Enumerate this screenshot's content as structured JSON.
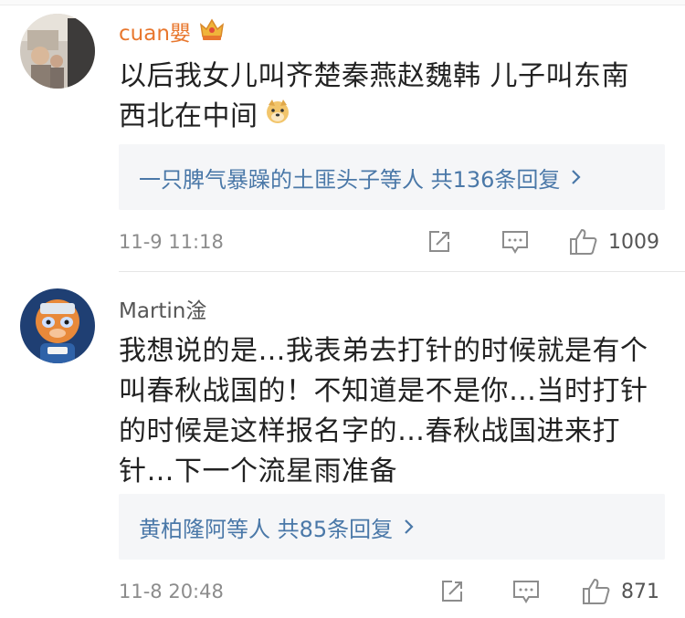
{
  "comments": [
    {
      "user": "cuan嬰",
      "text_lines": [
        "以后我女儿叫齐楚秦燕赵魏韩 儿子叫东南",
        "西北在中间"
      ],
      "replies": {
        "label": "一只脾气暴躁的土匪头子等人  共136条回复"
      },
      "time": "11-9 11:18",
      "likes": "1009",
      "name_color": "#e8772e"
    },
    {
      "user": "Martin淦",
      "text_lines": [
        "我想说的是…我表弟去打针的时候就是有个",
        "叫春秋战国的！不知道是不是你…当时打针",
        "的时候是这样报名字的…春秋战国进来打",
        "针…下一个流星雨准备"
      ],
      "replies": {
        "label": "黄柏隆阿等人  共85条回复"
      },
      "time": "11-8 20:48",
      "likes": "871",
      "name_color": "#555555"
    }
  ],
  "icons": {
    "badge": "crown-vip-icon",
    "emoji": "doge-emoji-icon",
    "share": "share-icon",
    "reply": "comment-icon",
    "like": "thumbs-up-icon",
    "chevron": "chevron-right-icon"
  },
  "colors": {
    "accent_name": "#e8772e",
    "link": "#4a78a8",
    "meta": "#8c8c8c",
    "reply_bg": "#f5f6f8"
  }
}
